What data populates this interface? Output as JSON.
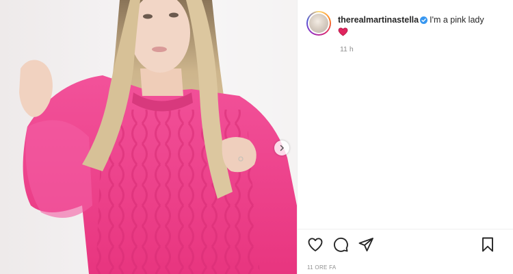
{
  "post": {
    "username": "therealmartinastella",
    "caption": "I'm a pink lady",
    "caption_emoji": "red-heart",
    "time_ago": "11 h",
    "date_label": "11 ORE FA"
  },
  "media": {
    "description_colors": {
      "sweater": "#f0478f",
      "hair": "#d9c39a",
      "background": "#f4f2f3"
    },
    "carousel_next_icon": "chevron-right-icon"
  },
  "actions": {
    "like_icon": "heart-outline-icon",
    "comment_icon": "comment-bubble-icon",
    "share_icon": "paper-plane-icon",
    "save_icon": "bookmark-icon"
  },
  "colors": {
    "verified": "#3897f0",
    "text": "#262626",
    "muted": "#8e8e8e"
  }
}
